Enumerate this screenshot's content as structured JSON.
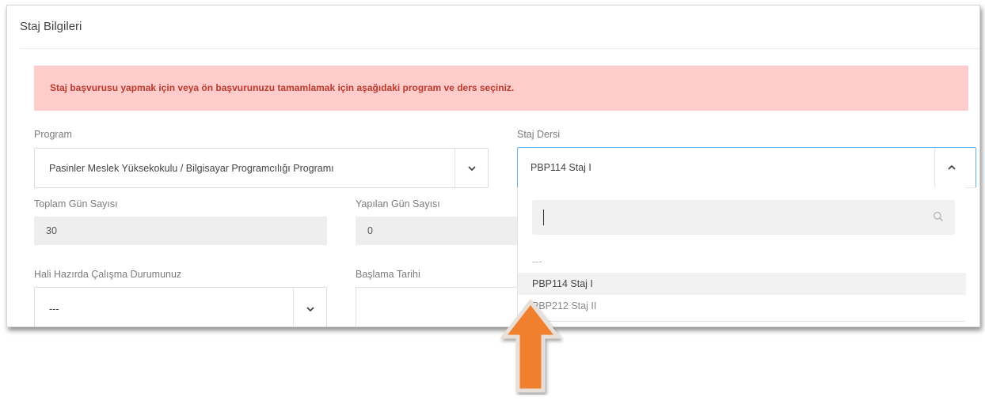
{
  "card": {
    "title": "Staj Bilgileri"
  },
  "alert": {
    "message": "Staj başvurusu yapmak için veya ön başvurunuzu tamamlamak için aşağıdaki program ve ders seçiniz."
  },
  "program": {
    "label": "Program",
    "selected": "Pasinler Meslek Yüksekokulu / Bilgisayar Programcılığı Programı"
  },
  "staj_dersi": {
    "label": "Staj Dersi",
    "selected": "PBP114 Staj I",
    "search_value": "",
    "options": [
      {
        "label": "---"
      },
      {
        "label": "PBP114 Staj I"
      },
      {
        "label": "PBP212 Staj II"
      }
    ]
  },
  "toplam_gun": {
    "label": "Toplam Gün Sayısı",
    "value": "30"
  },
  "yapilan_gun": {
    "label": "Yapılan Gün Sayısı",
    "value": "0"
  },
  "calisma_durumu": {
    "label": "Hali Hazırda Çalışma Durumunuz",
    "selected": "---"
  },
  "baslama_tarihi": {
    "label": "Başlama Tarihi"
  },
  "colors": {
    "alert_bg": "#ffcccc",
    "alert_text": "#c0392b",
    "focus_border": "#66afe9",
    "arrow_fill": "#f07f2e"
  },
  "icons": {
    "chevron_down": "chevron-down-icon",
    "chevron_up": "chevron-up-icon",
    "search": "search-icon",
    "pointer_arrow": "up-arrow-icon"
  }
}
